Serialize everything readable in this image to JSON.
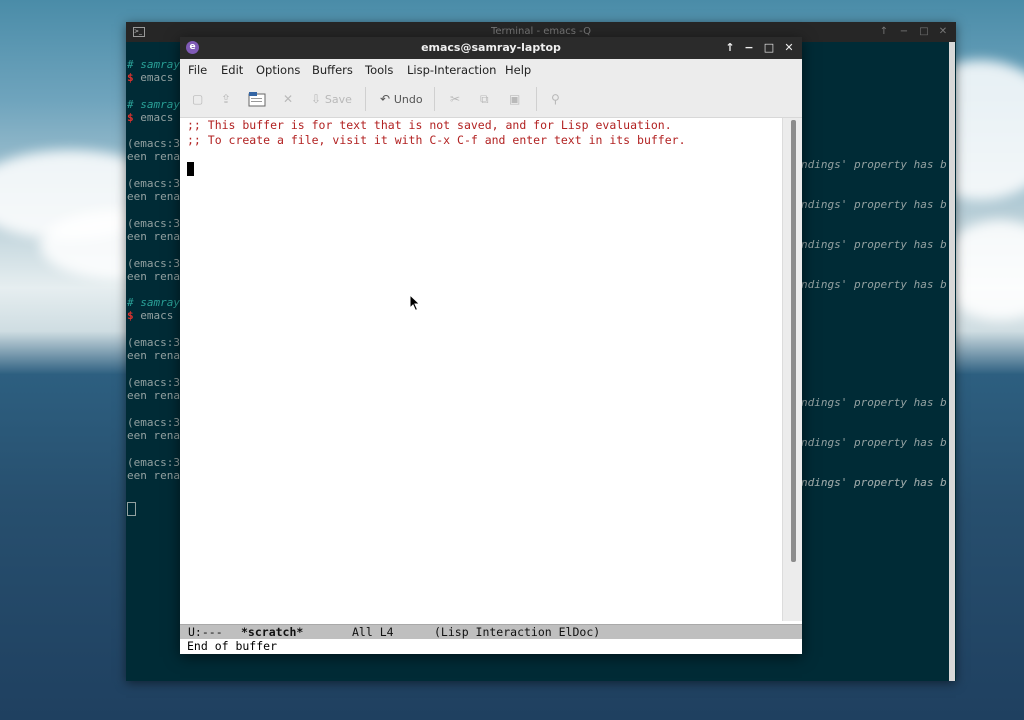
{
  "terminal": {
    "title": "Terminal - emacs -Q",
    "prompt_user": "# samray",
    "prompt_cmd": "$ emacs",
    "warning_left_a": "(emacs:3",
    "warning_left_b": "een rena",
    "warning_right": "ndings' property has b"
  },
  "emacs": {
    "title": "emacs@samray-laptop",
    "menu": [
      "File",
      "Edit",
      "Options",
      "Buffers",
      "Tools",
      "Lisp-Interaction",
      "Help"
    ],
    "toolbar": {
      "save_label": "Save",
      "undo_label": "Undo"
    },
    "buffer_lines": [
      ";; This buffer is for text that is not saved, and for Lisp evaluation.",
      ";; To create a file, visit it with C-x C-f and enter text in its buffer."
    ],
    "modeline": {
      "status": "U:---",
      "buffer_name": "*scratch*",
      "position": "All L4",
      "modes": "(Lisp Interaction ElDoc)"
    },
    "echo_area": "End of buffer"
  },
  "icons": {
    "terminal_app": "terminal-icon",
    "emacs_app": "emacs-icon",
    "window_controls": [
      "pin-up-icon",
      "minimize-icon",
      "maximize-icon",
      "close-icon"
    ]
  }
}
